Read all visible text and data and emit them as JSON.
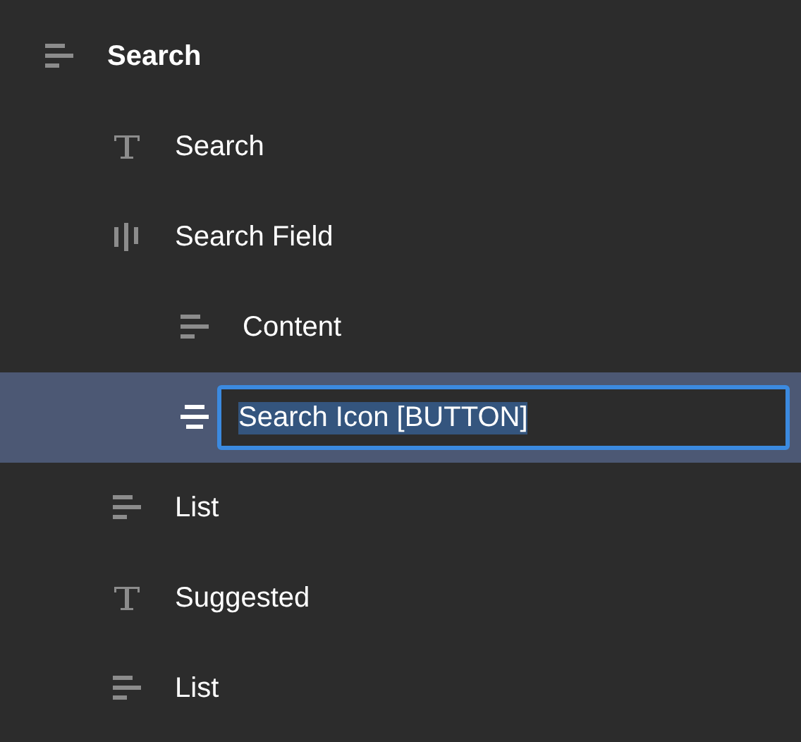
{
  "layers": [
    {
      "label": "Search",
      "kind": "stack",
      "selected": false,
      "editing": false,
      "children": [
        {
          "label": "Search",
          "kind": "text",
          "selected": false,
          "editing": false
        },
        {
          "label": "Search Field",
          "kind": "hstack",
          "selected": false,
          "editing": false,
          "children": [
            {
              "label": "Content",
              "kind": "stack",
              "selected": false,
              "editing": false
            },
            {
              "label": "Search Icon [BUTTON]",
              "kind": "center",
              "selected": true,
              "editing": true
            }
          ]
        },
        {
          "label": "List",
          "kind": "stack",
          "selected": false,
          "editing": false
        },
        {
          "label": "Suggested",
          "kind": "text",
          "selected": false,
          "editing": false
        },
        {
          "label": "List",
          "kind": "stack",
          "selected": false,
          "editing": false
        }
      ]
    }
  ]
}
